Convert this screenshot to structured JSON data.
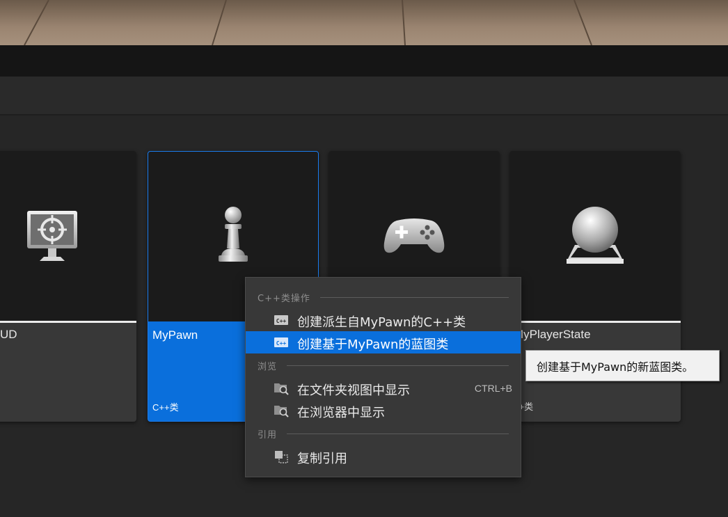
{
  "tiles": [
    {
      "name": "UD",
      "type": "",
      "icon": "monitor-target-icon",
      "selected": false
    },
    {
      "name": "MyPawn",
      "type": "C++类",
      "icon": "pawn-icon",
      "selected": true
    },
    {
      "name": "",
      "type": "",
      "icon": "gamepad-icon",
      "selected": false
    },
    {
      "name": "MyPlayerState",
      "type": "++类",
      "icon": "sphere-pedestal-icon",
      "selected": false
    }
  ],
  "context_menu": {
    "sections": {
      "cpp": "C++类操作",
      "browse": "浏览",
      "reference": "引用"
    },
    "items": {
      "create_derived_cpp": "创建派生自MyPawn的C++类",
      "create_blueprint": "创建基于MyPawn的蓝图类",
      "show_in_folder": "在文件夹视图中显示",
      "show_in_folder_shortcut": "CTRL+B",
      "show_in_browser": "在浏览器中显示",
      "copy_reference": "复制引用"
    }
  },
  "tooltip": "创建基于MyPawn的新蓝图类。",
  "colors": {
    "accent": "#0a6fdc",
    "background": "#262626",
    "tile": "#383838"
  }
}
